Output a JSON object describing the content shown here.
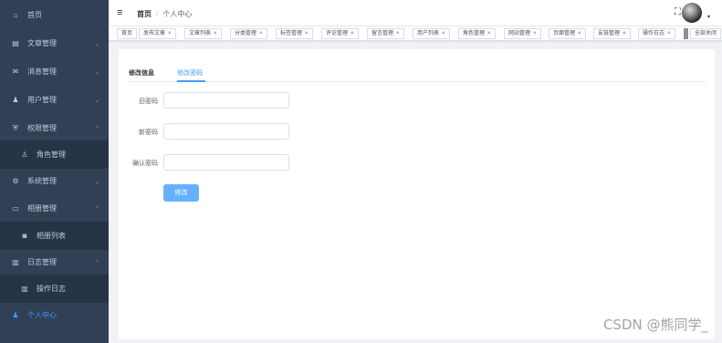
{
  "sidebar": {
    "items": [
      {
        "label": "首页",
        "icon": "home-icon",
        "glyph": "⌂",
        "arrow": ""
      },
      {
        "label": "文章管理",
        "icon": "document-icon",
        "glyph": "▤",
        "arrow": "⌄"
      },
      {
        "label": "消息管理",
        "icon": "message-icon",
        "glyph": "✉",
        "arrow": "⌄"
      },
      {
        "label": "用户管理",
        "icon": "user-icon",
        "glyph": "♟",
        "arrow": "⌄"
      },
      {
        "label": "权限管理",
        "icon": "lock-icon",
        "glyph": "⛨",
        "arrow": "⌃"
      },
      {
        "label": "角色管理",
        "icon": "people-icon",
        "glyph": "♙",
        "arrow": ""
      },
      {
        "label": "系统管理",
        "icon": "gear-icon",
        "glyph": "⚙",
        "arrow": "⌄"
      },
      {
        "label": "相册管理",
        "icon": "album-icon",
        "glyph": "▭",
        "arrow": "⌃"
      },
      {
        "label": "相册列表",
        "icon": "camera-icon",
        "glyph": "◙",
        "arrow": ""
      },
      {
        "label": "日志管理",
        "icon": "log-icon",
        "glyph": "▥",
        "arrow": "⌃"
      },
      {
        "label": "操作日志",
        "icon": "operation-log-icon",
        "glyph": "▥",
        "arrow": ""
      },
      {
        "label": "个人中心",
        "icon": "person-icon",
        "glyph": "♟",
        "arrow": ""
      }
    ]
  },
  "header": {
    "menu_icon": "≡",
    "breadcrumb_home": "首页",
    "breadcrumb_sep": "/",
    "breadcrumb_current": "个人中心",
    "fullscreen_icon": "⛶",
    "caret": "▾"
  },
  "tags": {
    "items": [
      "首页",
      "发布文章",
      "文章列表",
      "分类管理",
      "标签管理",
      "评论管理",
      "留言管理",
      "用户列表",
      "角色管理",
      "网站管理",
      "页面管理",
      "友链管理",
      "操作日志"
    ],
    "close_glyph": "×",
    "close_all": "全部关闭"
  },
  "content": {
    "tabs": [
      "修改信息",
      "修改密码"
    ],
    "active_tab": "修改密码",
    "fields": [
      {
        "label": "旧密码",
        "value": ""
      },
      {
        "label": "新密码",
        "value": ""
      },
      {
        "label": "确认密码",
        "value": ""
      }
    ],
    "submit_label": "修改"
  },
  "watermark": "CSDN @熊同学_",
  "colors": {
    "sidebar_bg": "#304156",
    "accent": "#409eff",
    "button": "#66b1ff"
  }
}
